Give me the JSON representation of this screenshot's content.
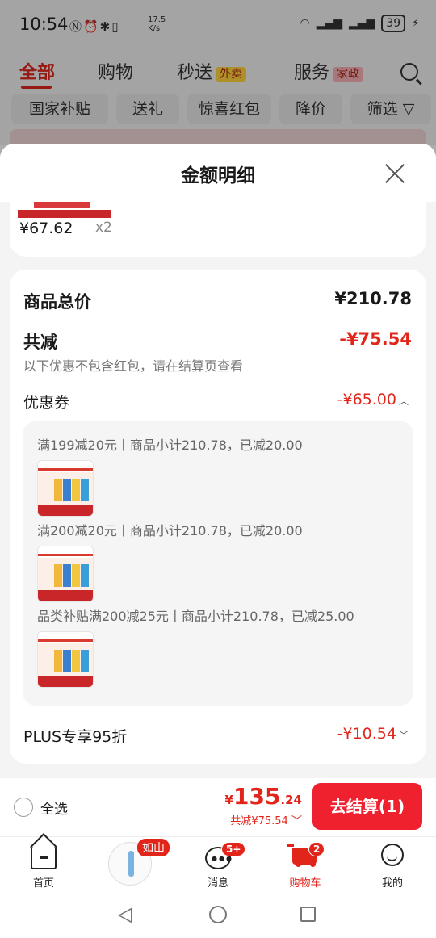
{
  "status_bar": {
    "time": "10:54",
    "speed_value": "17.5",
    "speed_unit": "K/s",
    "battery": "39"
  },
  "header": {
    "tabs": [
      {
        "label": "全部",
        "active": true
      },
      {
        "label": "购物"
      },
      {
        "label": "秒送",
        "tag": "外卖"
      },
      {
        "label": "服务",
        "tag": "家政"
      }
    ],
    "chips": [
      "国家补贴",
      "送礼",
      "惊喜红包",
      "降价",
      "筛选"
    ]
  },
  "sheet": {
    "title": "金额明细",
    "first_item": {
      "price": "¥67.62",
      "qty": "x2"
    },
    "summary": {
      "total_label": "商品总价",
      "total_value": "¥210.78",
      "discount_label": "共减",
      "discount_value": "-¥75.54",
      "note": "以下优惠不包含红包，请在结算页查看",
      "coupon_label": "优惠券",
      "coupon_value": "-¥65.00",
      "rules": [
        "满199减20元丨商品小计210.78，已减20.00",
        "满200减20元丨商品小计210.78，已减20.00",
        "品类补贴满200减25元丨商品小计210.78，已减25.00"
      ],
      "plus_label": "PLUS专享95折",
      "plus_value": "-¥10.54"
    }
  },
  "checkout": {
    "select_all": "全选",
    "currency": "¥",
    "amount_int": "135",
    "amount_dec": ".24",
    "saved": "共减¥75.54",
    "pay_button": "去结算(1)"
  },
  "bottom_nav": {
    "items": [
      {
        "label": "首页"
      },
      {
        "label": "",
        "tag": "如山"
      },
      {
        "label": "消息",
        "badge": "5+"
      },
      {
        "label": "购物车",
        "badge": "2",
        "active": true
      },
      {
        "label": "我的"
      }
    ]
  },
  "colors": {
    "accent": "#e1251b",
    "pay_button": "#f0212e"
  }
}
